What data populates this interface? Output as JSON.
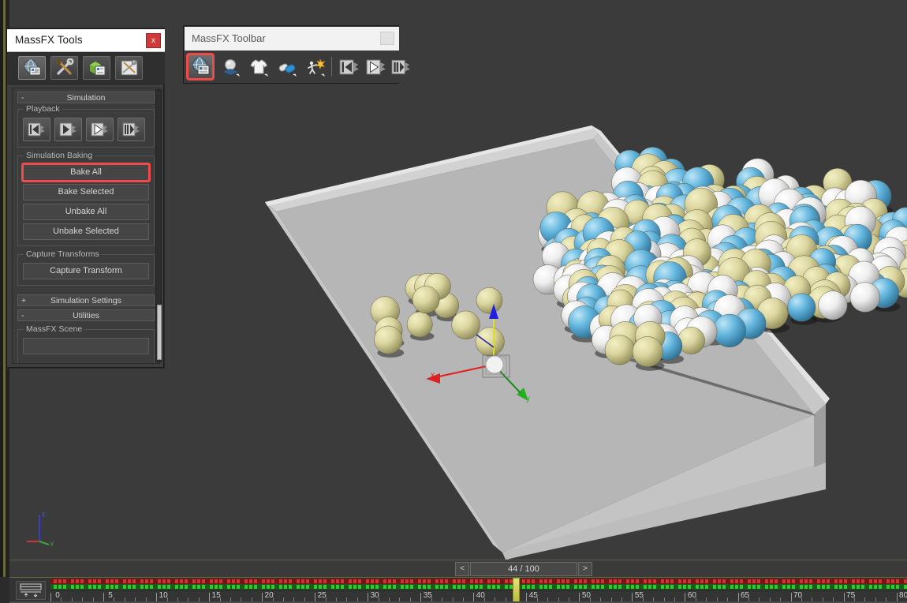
{
  "app": {
    "background_color": "#2b2b2b",
    "viewport_color": "#3b3b3b"
  },
  "massfx_panel": {
    "title": "MassFX Tools",
    "close_label": "x",
    "tabs": [
      {
        "name": "world-tab",
        "icon": "globe-world-icon",
        "selected": true,
        "tooltip": "World"
      },
      {
        "name": "tools-tab",
        "icon": "wrench-tools-icon",
        "selected": false,
        "tooltip": "Tools"
      },
      {
        "name": "objects-tab",
        "icon": "cube-objects-icon",
        "selected": false,
        "tooltip": "Multi-Object Editor"
      },
      {
        "name": "display-tab",
        "icon": "display-icon",
        "selected": false,
        "tooltip": "Display Options"
      }
    ],
    "rollouts": [
      {
        "label": "Simulation",
        "state": "-",
        "expanded": true
      },
      {
        "label": "Simulation Settings",
        "state": "+",
        "expanded": false
      },
      {
        "label": "Utilities",
        "state": "-",
        "expanded": true
      }
    ],
    "playback_group": {
      "label": "Playback",
      "buttons": [
        {
          "name": "reset-simulation-button",
          "icon": "rewind-to-start-icon"
        },
        {
          "name": "start-simulation-button",
          "icon": "play-simulation-icon"
        },
        {
          "name": "play-simulation-button",
          "icon": "play-icon"
        },
        {
          "name": "step-simulation-button",
          "icon": "step-frame-icon"
        }
      ]
    },
    "simulation_baking": {
      "label": "Simulation Baking",
      "buttons": [
        {
          "label": "Bake All",
          "highlighted": true
        },
        {
          "label": "Bake Selected",
          "highlighted": false
        },
        {
          "label": "Unbake All",
          "highlighted": false
        },
        {
          "label": "Unbake Selected",
          "highlighted": false
        }
      ]
    },
    "capture_transforms": {
      "label": "Capture Transforms",
      "buttons": [
        {
          "label": "Capture Transform",
          "highlighted": false
        }
      ]
    },
    "utilities": {
      "group_label": "MassFX Scene"
    },
    "highlight_color": "#f04a4a"
  },
  "massfx_toolbar": {
    "title": "MassFX Toolbar",
    "minimize_label": "",
    "icons": [
      {
        "name": "massfx-world-button",
        "icon": "globe-world-icon",
        "selected": true
      },
      {
        "name": "rigid-body-button",
        "icon": "rigid-body-icon",
        "selected": false
      },
      {
        "name": "mcloth-button",
        "icon": "cloth-shirt-icon",
        "selected": false
      },
      {
        "name": "constraint-button",
        "icon": "constraint-icon",
        "selected": false
      },
      {
        "name": "ragdoll-button",
        "icon": "ragdoll-icon",
        "selected": false
      },
      {
        "name": "reset-simulation-button",
        "icon": "rewind-to-start-icon",
        "selected": false
      },
      {
        "name": "play-simulation-button",
        "icon": "play-icon",
        "selected": false
      },
      {
        "name": "step-simulation-button",
        "icon": "step-frame-icon",
        "selected": false
      }
    ]
  },
  "time_slider": {
    "current_frame": 44,
    "total_frames": 100,
    "label": "44 / 100",
    "prev_label": "<",
    "next_label": ">"
  },
  "track_bar": {
    "animation_mode_icon": "animation-mode-icon",
    "ruler_labels": [
      "0",
      "5",
      "10",
      "15",
      "20",
      "25",
      "30",
      "35",
      "40",
      "45",
      "50",
      "55",
      "60",
      "65",
      "70",
      "75",
      "80"
    ],
    "ruler_values": [
      0,
      5,
      10,
      15,
      20,
      25,
      30,
      35,
      40,
      45,
      50,
      55,
      60,
      65,
      70,
      75,
      80
    ],
    "playhead_frame": 44,
    "key_color_top": "#d63030",
    "key_color_bottom": "#2ecb2e"
  },
  "viewport": {
    "axis_tripod": {
      "x_label": "x",
      "y_label": "y",
      "z_label": "z",
      "x_color": "#c43a3a",
      "y_color": "#3aa83a",
      "z_color": "#3a3ac4"
    },
    "transform_gizmo": {
      "x_color": "#e02020",
      "y_color": "#20b020",
      "z_color": "#2020e0"
    },
    "scene": {
      "box_color": "#c9c9c9",
      "box_floor_color": "#b4b4b4",
      "sphere_colors": [
        "#d6d19a",
        "#62b4dd",
        "#f2f2f2"
      ],
      "sphere_count": 150
    }
  }
}
